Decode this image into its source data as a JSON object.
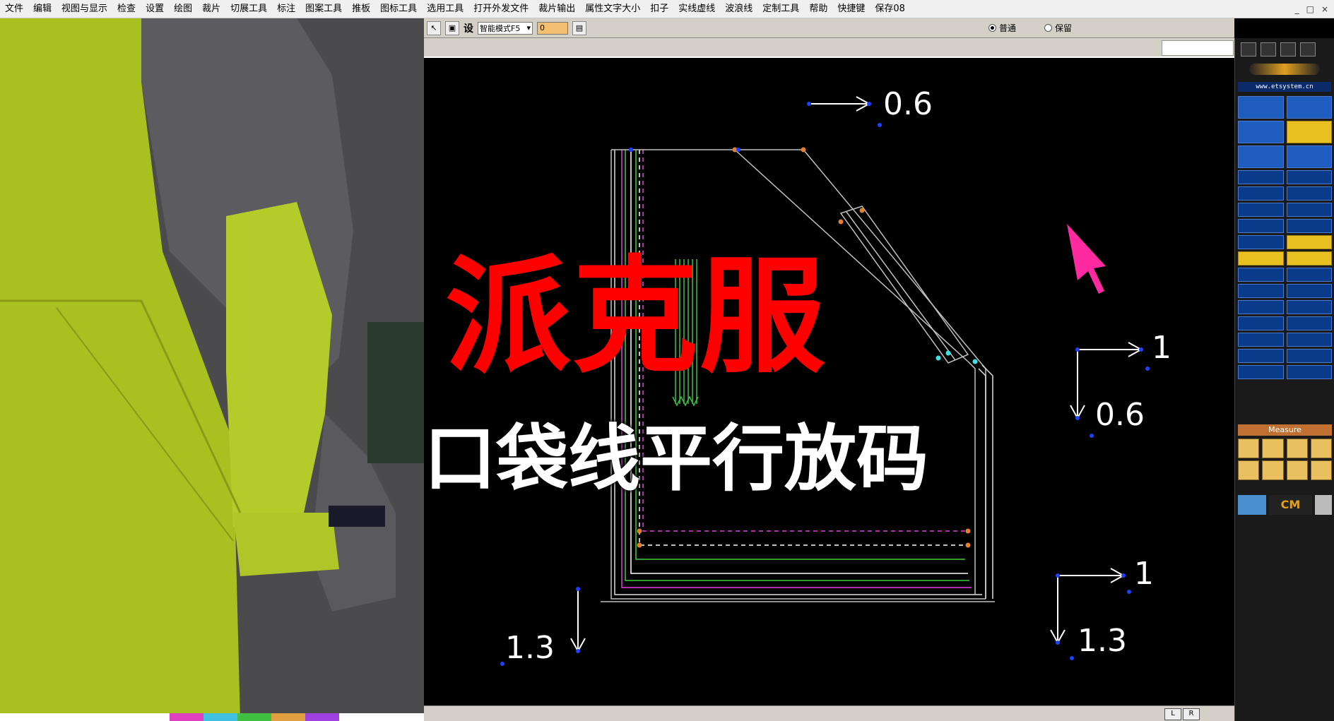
{
  "menu": {
    "items": [
      "文件",
      "编辑",
      "视图与显示",
      "检查",
      "设置",
      "绘图",
      "裁片",
      "切展工具",
      "标注",
      "图案工具",
      "推板",
      "图标工具",
      "选用工具",
      "打开外发文件",
      "裁片输出",
      "属性文字大小",
      "扣子",
      "实线虚线",
      "波浪线",
      "定制工具",
      "帮助",
      "快捷键",
      "保存08"
    ],
    "window_controls": [
      "_",
      "□",
      "×"
    ]
  },
  "toolbar": {
    "set_label": "设",
    "mode_select": "智能模式F5",
    "mode_value": "0",
    "radio_normal": "普通",
    "radio_keep": "保留",
    "radio_selected": "普通"
  },
  "right_panel": {
    "url": "www.etsystem.cn",
    "measure_label": "Measure",
    "unit_label": "CM"
  },
  "scroll": {
    "left_label": "L",
    "right_label": "R"
  },
  "overlay": {
    "title": "派克服",
    "subtitle": "口袋线平行放码"
  },
  "dimensions": {
    "top_right_small": "0.6",
    "right_mid_top": "1",
    "right_mid_bottom": "0.6",
    "bottom_right_top": "1",
    "bottom_right_bottom": "1.3",
    "bottom_left": "1.3"
  },
  "colors": {
    "canvas_bg": "#000000",
    "title_red": "#ff0000",
    "cursor_magenta": "#ff2aa0"
  }
}
